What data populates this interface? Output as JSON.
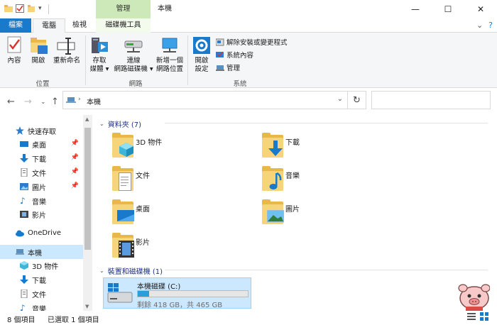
{
  "title_bar": {
    "context_tab": "管理",
    "title": "本機",
    "minimize": "—",
    "maximize": "☐",
    "close": "✕"
  },
  "tabs": {
    "file": "檔案",
    "computer": "電腦",
    "view": "檢視",
    "disk_tools": "磁碟機工具"
  },
  "ribbon": {
    "location": {
      "properties": "內容",
      "open": "開啟",
      "rename": "重新命名",
      "group": "位置"
    },
    "network": {
      "access_media_1": "存取",
      "access_media_2": "媒體 ▾",
      "map_drive_1": "連線",
      "map_drive_2": "網路磁碟機 ▾",
      "add_location_1": "新增一個",
      "add_location_2": "網路位置",
      "group": "網路"
    },
    "system": {
      "open_settings_1": "開啟",
      "open_settings_2": "設定",
      "uninstall": "解除安裝或變更程式",
      "system_properties": "系統內容",
      "manage": "管理",
      "group": "系統"
    }
  },
  "address": {
    "crumb": "本機"
  },
  "nav": {
    "quick_access": "快速存取",
    "items": [
      {
        "label": "桌面"
      },
      {
        "label": "下載"
      },
      {
        "label": "文件"
      },
      {
        "label": "圖片"
      },
      {
        "label": "音樂"
      },
      {
        "label": "影片"
      }
    ],
    "onedrive": "OneDrive",
    "this_pc": "本機",
    "pc_items": [
      {
        "label": "3D 物件"
      },
      {
        "label": "下載"
      },
      {
        "label": "文件"
      },
      {
        "label": "音樂"
      }
    ]
  },
  "content": {
    "folders_header": "資料夾 (7)",
    "folders": [
      {
        "name": "3D 物件"
      },
      {
        "name": "下載"
      },
      {
        "name": "文件"
      },
      {
        "name": "音樂"
      },
      {
        "name": "桌面"
      },
      {
        "name": "圖片"
      },
      {
        "name": "影片"
      }
    ],
    "devices_header": "裝置和磁碟機 (1)",
    "drive": {
      "name": "本機磁碟 (C:)",
      "size_text": "剩餘 418 GB，共 465 GB",
      "used_fraction": 0.1
    }
  },
  "status": {
    "count": "8 個項目",
    "selected": "已選取 1 個項目"
  },
  "colors": {
    "accent": "#1979ca",
    "selection": "#cce8ff",
    "context_tab": "#cde8b9",
    "folder": "#f5d47a"
  }
}
